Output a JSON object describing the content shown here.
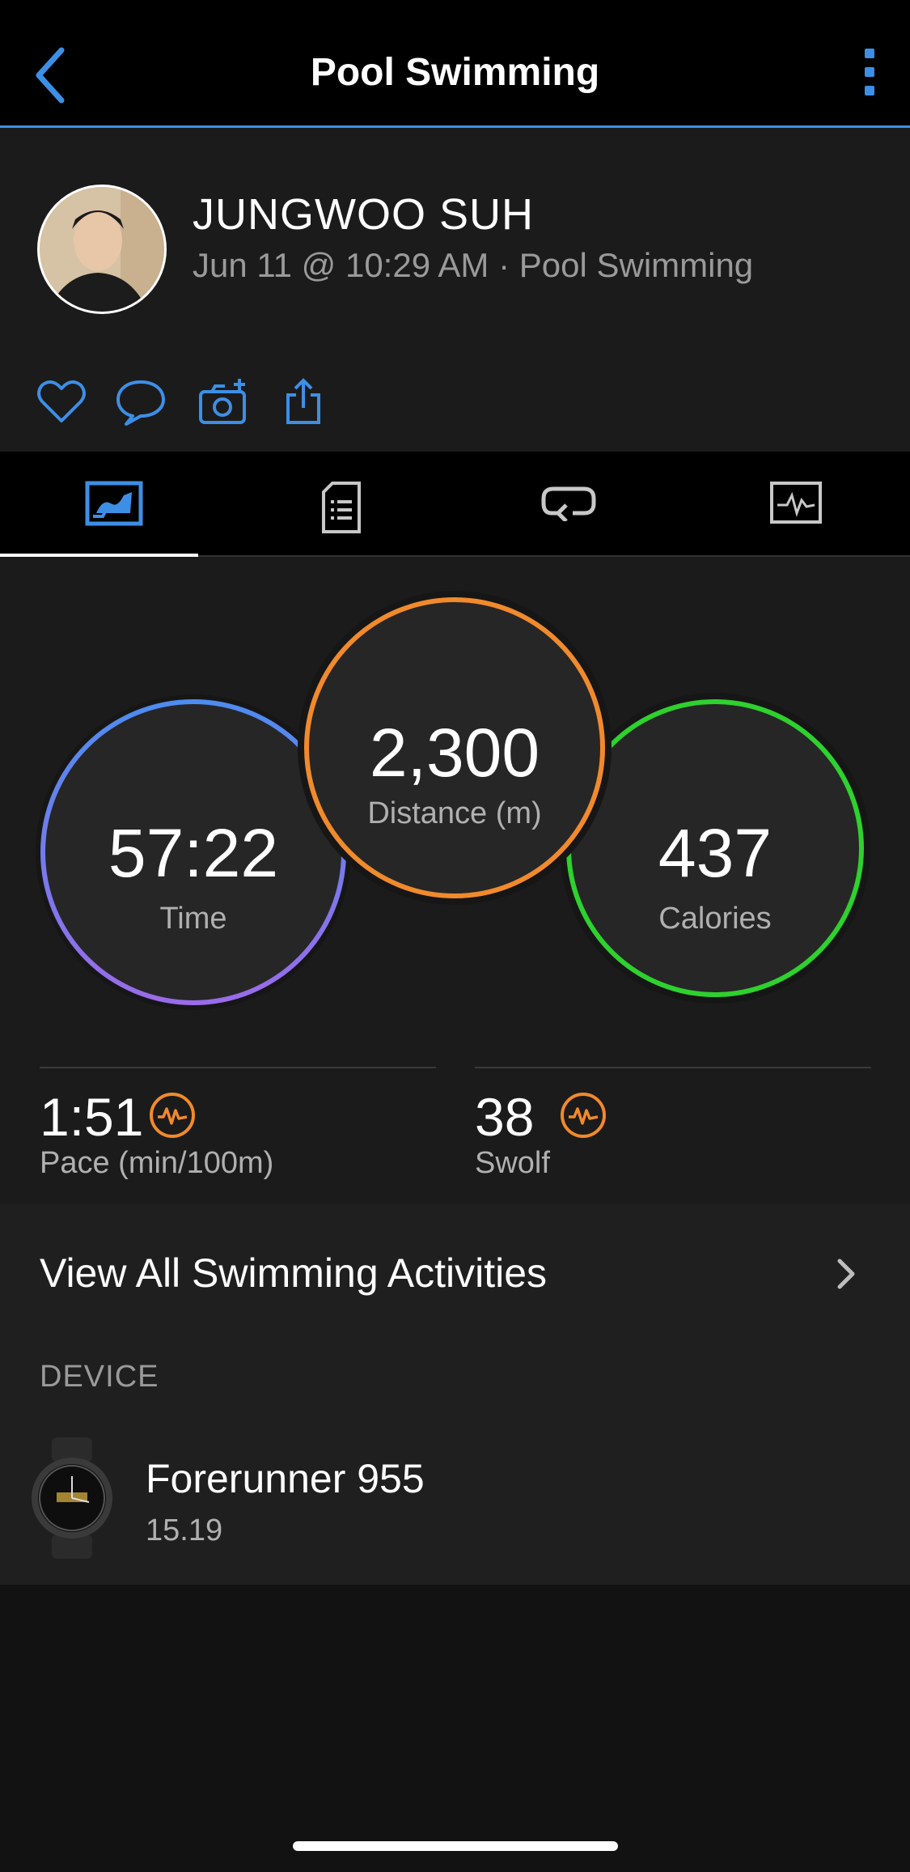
{
  "header": {
    "title": "Pool Swimming"
  },
  "user": {
    "name": "JUNGWOO SUH",
    "meta": "Jun 11 @ 10:29 AM · Pool Swimming"
  },
  "stats": {
    "time": {
      "value": "57:22",
      "label": "Time"
    },
    "distance": {
      "value": "2,300",
      "label": "Distance (m)"
    },
    "calories": {
      "value": "437",
      "label": "Calories"
    }
  },
  "metrics": {
    "pace": {
      "value": "1:51",
      "label": "Pace (min/100m)"
    },
    "swolf": {
      "value": "38",
      "label": "Swolf"
    }
  },
  "view_all": {
    "label": "View All Swimming Activities"
  },
  "device": {
    "section_label": "DEVICE",
    "name": "Forerunner 955",
    "version": "15.19"
  },
  "colors": {
    "accent": "#3d8fe6",
    "distance": "#f18a2c",
    "calories": "#2ed12e",
    "time_top": "#4d8cf0",
    "time_bottom": "#9a6bea"
  },
  "icons": [
    "back-arrow-icon",
    "more-vertical-icon",
    "heart-icon",
    "comment-icon",
    "add-photo-icon",
    "share-icon",
    "overview-tab-icon",
    "details-tab-icon",
    "laps-tab-icon",
    "charts-tab-icon",
    "performance-icon",
    "chevron-right-icon",
    "watch-icon"
  ]
}
